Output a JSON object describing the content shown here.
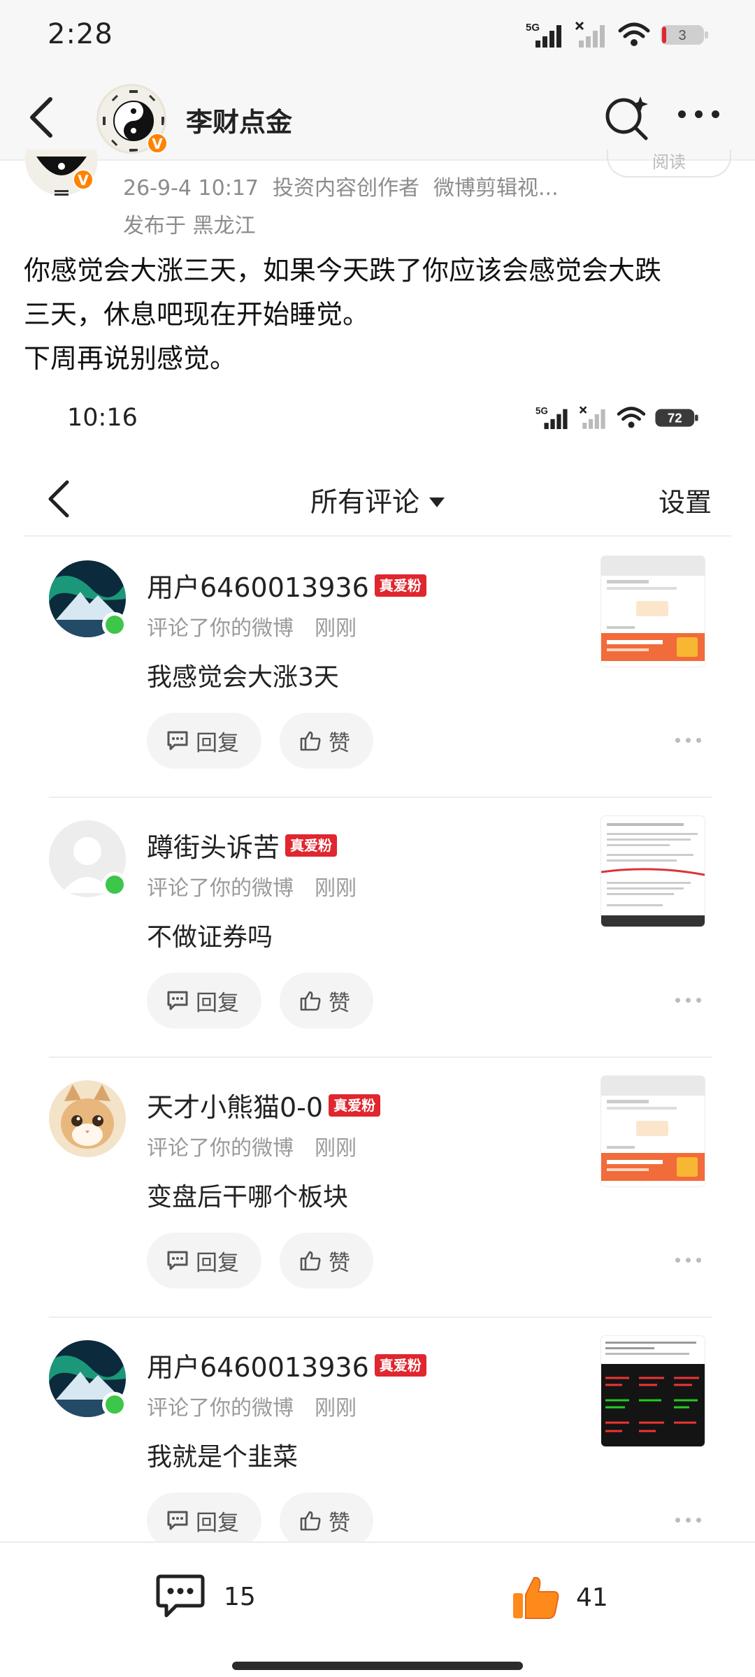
{
  "status_bar": {
    "time": "2:28",
    "network": "5G",
    "battery": "3"
  },
  "nav": {
    "account_name": "李财点金",
    "verified_badge": "V"
  },
  "post": {
    "meta_time": "26-9-4 10:17",
    "meta_role": "投资内容创作者",
    "meta_source": "微博剪辑视...",
    "location": "发布于 黑龙江",
    "follow_label": "阅读",
    "text_lines": [
      "你感觉会大涨三天，如果今天跌了你应该会感觉会大跌",
      "三天，休息吧现在开始睡觉。",
      "下周再说别感觉。"
    ]
  },
  "screenshot": {
    "status": {
      "time": "10:16",
      "network": "5G",
      "battery": "72"
    },
    "header": {
      "title": "所有评论",
      "settings": "设置"
    },
    "comments": [
      {
        "user": "用户6460013936",
        "badge": "真爱粉",
        "action": "评论了你的微博",
        "time": "刚刚",
        "text": "我感觉会大涨3天",
        "reply_label": "回复",
        "like_label": "赞",
        "avatar_kind": "aurora",
        "thumb_kind": "promo"
      },
      {
        "user": "蹲街头诉苦",
        "badge": "真爱粉",
        "action": "评论了你的微博",
        "time": "刚刚",
        "text": "不做证券吗",
        "reply_label": "回复",
        "like_label": "赞",
        "avatar_kind": "default",
        "thumb_kind": "text"
      },
      {
        "user": "天才小熊猫0-0",
        "badge": "真爱粉",
        "action": "评论了你的微博",
        "time": "刚刚",
        "text": "变盘后干哪个板块",
        "reply_label": "回复",
        "like_label": "赞",
        "avatar_kind": "cat",
        "thumb_kind": "promo"
      },
      {
        "user": "用户6460013936",
        "badge": "真爱粉",
        "action": "评论了你的微博",
        "time": "刚刚",
        "text": "我就是个韭菜",
        "reply_label": "回复",
        "like_label": "赞",
        "avatar_kind": "aurora",
        "thumb_kind": "dark"
      }
    ]
  },
  "bottom_bar": {
    "comment_count": "15",
    "like_count": "41"
  },
  "colors": {
    "accent_orange": "#ff8200",
    "fan_badge": "#e0262e",
    "online_dot": "#3dc64a",
    "muted_text": "#9a9a9a"
  }
}
